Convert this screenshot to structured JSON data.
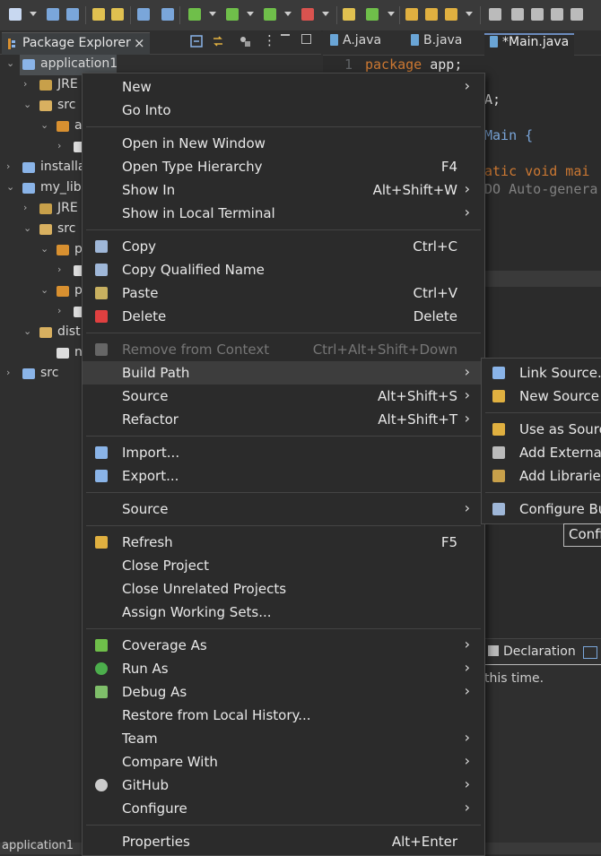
{
  "package_explorer": {
    "tab_label": "Package Explorer",
    "tree": [
      {
        "label": "application1",
        "arrow": "⌄",
        "indent": 0,
        "icon_color": "#8ab4e8",
        "selected": true
      },
      {
        "label": "JRE",
        "arrow": "›",
        "indent": 1,
        "icon_color": "#c8a04a"
      },
      {
        "label": "src",
        "arrow": "⌄",
        "indent": 1,
        "icon_color": "#d8b060"
      },
      {
        "label": "a",
        "arrow": "⌄",
        "indent": 2,
        "icon_color": "#d89030"
      },
      {
        "label": "",
        "arrow": "›",
        "indent": 3,
        "icon_color": "#dddddd"
      },
      {
        "label": "installa",
        "arrow": "›",
        "indent": 0,
        "icon_color": "#8ab4e8"
      },
      {
        "label": "my_lib",
        "arrow": "⌄",
        "indent": 0,
        "icon_color": "#8ab4e8"
      },
      {
        "label": "JRE",
        "arrow": "›",
        "indent": 1,
        "icon_color": "#c8a04a"
      },
      {
        "label": "src",
        "arrow": "⌄",
        "indent": 1,
        "icon_color": "#d8b060"
      },
      {
        "label": "p",
        "arrow": "⌄",
        "indent": 2,
        "icon_color": "#d89030"
      },
      {
        "label": "",
        "arrow": "›",
        "indent": 3,
        "icon_color": "#dddddd"
      },
      {
        "label": "p",
        "arrow": "⌄",
        "indent": 2,
        "icon_color": "#d89030"
      },
      {
        "label": "",
        "arrow": "›",
        "indent": 3,
        "icon_color": "#dddddd"
      },
      {
        "label": "dist",
        "arrow": "⌄",
        "indent": 1,
        "icon_color": "#d8b060"
      },
      {
        "label": "n",
        "arrow": "",
        "indent": 2,
        "icon_color": "#dddddd"
      },
      {
        "label": "src",
        "arrow": "›",
        "indent": 0,
        "icon_color": "#8ab4e8"
      }
    ]
  },
  "editor": {
    "tabs": [
      {
        "label": "A.java",
        "active": false
      },
      {
        "label": "B.java",
        "active": false
      },
      {
        "label": "*Main.java",
        "active": true
      }
    ],
    "line_number": "1",
    "code_line1_kw": "package",
    "code_line1_rest": " app;",
    "code_frag_a": "A;",
    "code_frag_main": "Main {",
    "code_frag_static": "atic void mai",
    "code_frag_todo": "DO Auto-genera"
  },
  "bottom_panel": {
    "tab_label": "Declaration",
    "message": "this time."
  },
  "status_bar": {
    "text": "application1"
  },
  "context_menu": {
    "items": [
      {
        "label": "New",
        "submenu": true
      },
      {
        "label": "Go Into"
      },
      {
        "sep": true
      },
      {
        "label": "Open in New Window"
      },
      {
        "label": "Open Type Hierarchy",
        "accel": "F4"
      },
      {
        "label": "Show In",
        "accel": "Alt+Shift+W",
        "submenu": true
      },
      {
        "label": "Show in Local Terminal",
        "submenu": true
      },
      {
        "sep": true
      },
      {
        "label": "Copy",
        "accel": "Ctrl+C",
        "icon": "copy-icon"
      },
      {
        "label": "Copy Qualified Name",
        "icon": "copy-qualified-icon"
      },
      {
        "label": "Paste",
        "accel": "Ctrl+V",
        "icon": "paste-icon"
      },
      {
        "label": "Delete",
        "accel": "Delete",
        "icon": "delete-icon"
      },
      {
        "sep": true
      },
      {
        "label": "Remove from Context",
        "accel": "Ctrl+Alt+Shift+Down",
        "disabled": true,
        "icon": "remove-context-icon"
      },
      {
        "label": "Build Path",
        "submenu": true,
        "highlight": true
      },
      {
        "label": "Source",
        "accel": "Alt+Shift+S",
        "submenu": true
      },
      {
        "label": "Refactor",
        "accel": "Alt+Shift+T",
        "submenu": true
      },
      {
        "sep": true
      },
      {
        "label": "Import...",
        "icon": "import-icon"
      },
      {
        "label": "Export...",
        "icon": "export-icon"
      },
      {
        "sep": true
      },
      {
        "label": "Source",
        "submenu": true
      },
      {
        "sep": true
      },
      {
        "label": "Refresh",
        "accel": "F5",
        "icon": "refresh-icon"
      },
      {
        "label": "Close Project"
      },
      {
        "label": "Close Unrelated Projects"
      },
      {
        "label": "Assign Working Sets..."
      },
      {
        "sep": true
      },
      {
        "label": "Coverage As",
        "submenu": true,
        "icon": "coverage-icon"
      },
      {
        "label": "Run As",
        "submenu": true,
        "icon": "run-icon"
      },
      {
        "label": "Debug As",
        "submenu": true,
        "icon": "debug-icon"
      },
      {
        "label": "Restore from Local History..."
      },
      {
        "label": "Team",
        "submenu": true
      },
      {
        "label": "Compare With",
        "submenu": true
      },
      {
        "label": "GitHub",
        "submenu": true,
        "icon": "github-icon"
      },
      {
        "label": "Configure",
        "submenu": true
      },
      {
        "sep": true
      },
      {
        "label": "Properties",
        "accel": "Alt+Enter"
      }
    ]
  },
  "build_path_submenu": {
    "items": [
      {
        "label": "Link Source...",
        "icon": "link-source-icon"
      },
      {
        "label": "New Source F",
        "icon": "new-source-folder-icon"
      },
      {
        "sep": true
      },
      {
        "label": "Use as Source",
        "icon": "use-as-source-icon"
      },
      {
        "label": "Add External",
        "icon": "add-external-icon"
      },
      {
        "label": "Add Libraries.",
        "icon": "add-libraries-icon"
      },
      {
        "sep": true
      },
      {
        "label": "Configure Bu",
        "icon": "configure-build-icon"
      }
    ]
  },
  "tooltip": {
    "text": "Confi"
  }
}
